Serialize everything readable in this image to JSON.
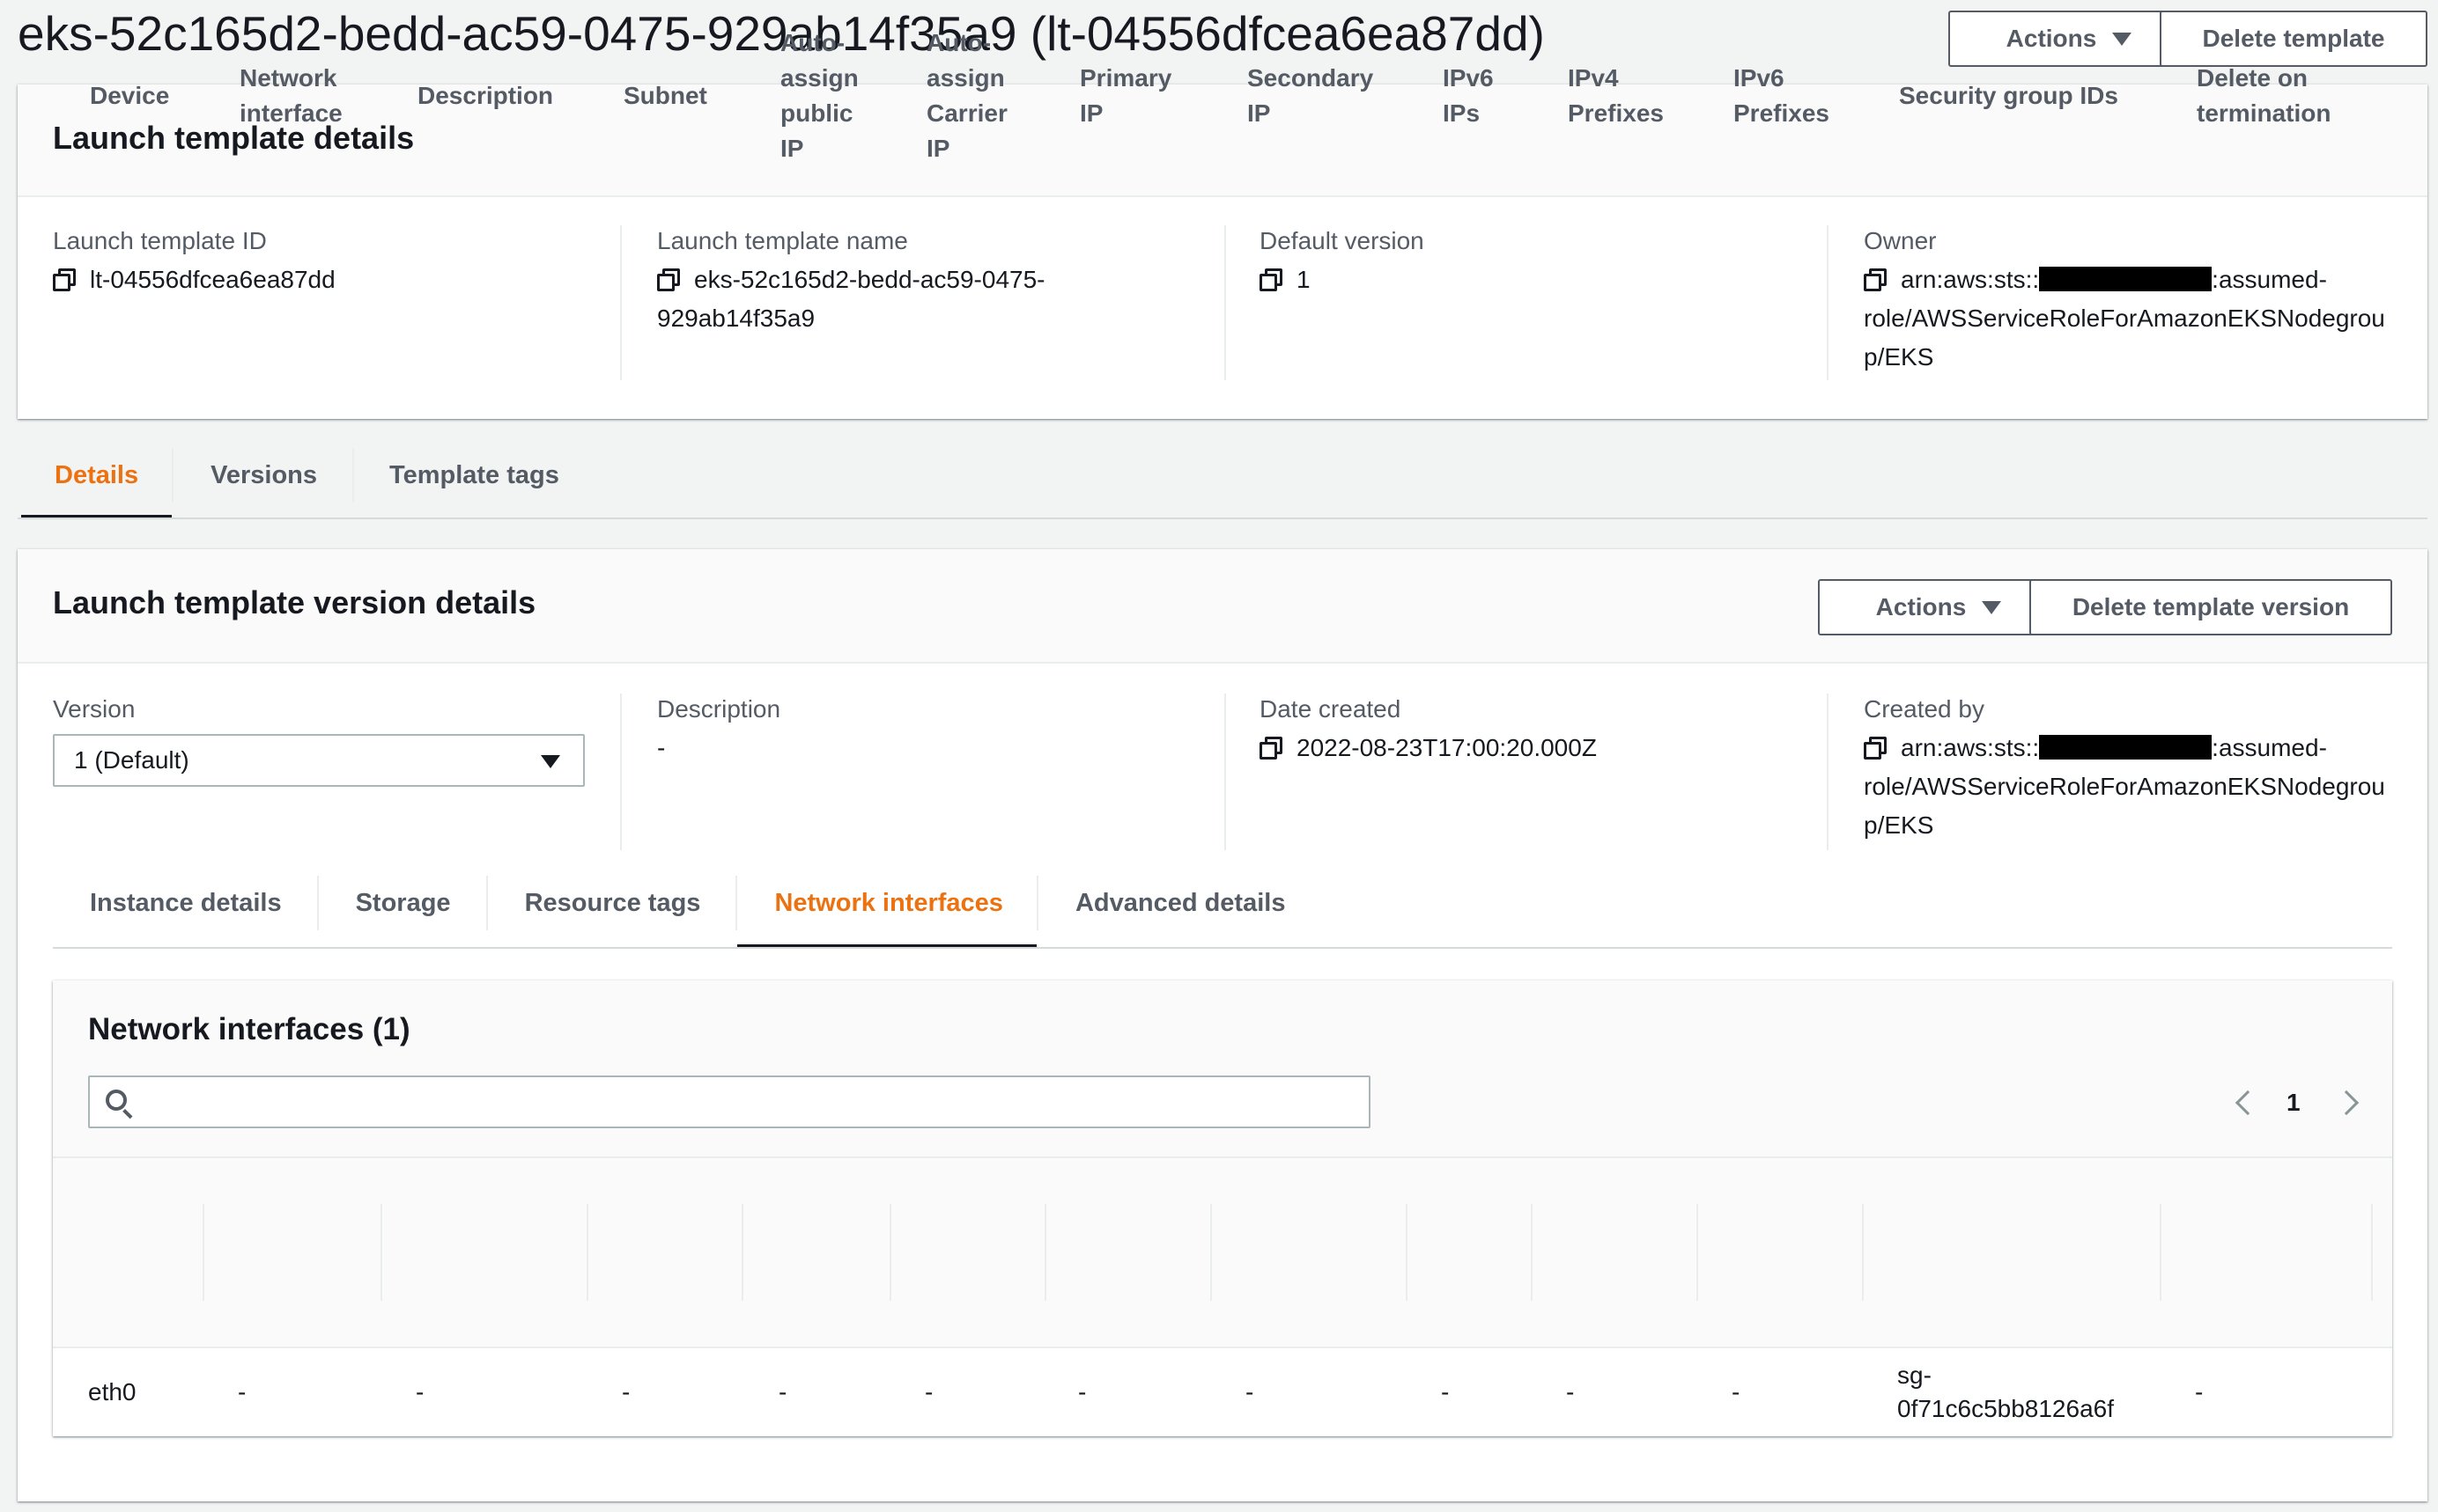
{
  "page": {
    "title": "eks-52c165d2-bedd-ac59-0475-929ab14f35a9 (lt-04556dfcea6ea87dd)",
    "actions_label": "Actions",
    "delete_label": "Delete template"
  },
  "template_details": {
    "title": "Launch template details",
    "fields": [
      {
        "label": "Launch template ID",
        "value": "lt-04556dfcea6ea87dd"
      },
      {
        "label": "Launch template name",
        "value_line1": "eks-52c165d2-bedd-ac59-0475-",
        "value_line2": "929ab14f35a9"
      },
      {
        "label": "Default version",
        "value": "1"
      },
      {
        "label": "Owner",
        "value_prefix": "arn:aws:sts::",
        "value_suffix": ":assumed-",
        "value_line2": "role/AWSServiceRoleForAmazonEKSNodegrou",
        "value_line3": "p/EKS"
      }
    ]
  },
  "main_tabs": [
    {
      "label": "Details",
      "active": true
    },
    {
      "label": "Versions",
      "active": false
    },
    {
      "label": "Template tags",
      "active": false
    }
  ],
  "version_details": {
    "title": "Launch template version details",
    "actions_label": "Actions",
    "delete_label": "Delete template version",
    "version": {
      "label": "Version",
      "selected": "1 (Default)"
    },
    "description": {
      "label": "Description",
      "value": "-"
    },
    "date_created": {
      "label": "Date created",
      "value": "2022-08-23T17:00:20.000Z"
    },
    "created_by": {
      "label": "Created by",
      "value_prefix": "arn:aws:sts::",
      "value_suffix": ":assumed-",
      "value_line2": "role/AWSServiceRoleForAmazonEKSNodegrou",
      "value_line3": "p/EKS"
    }
  },
  "sub_tabs": [
    {
      "label": "Instance details",
      "active": false
    },
    {
      "label": "Storage",
      "active": false
    },
    {
      "label": "Resource tags",
      "active": false
    },
    {
      "label": "Network interfaces",
      "active": true
    },
    {
      "label": "Advanced details",
      "active": false
    }
  ],
  "network_interfaces": {
    "title": "Network interfaces (1)",
    "search_placeholder": "",
    "page_number": "1",
    "columns": [
      [
        "Device"
      ],
      [
        "Network",
        "interface"
      ],
      [
        "Description"
      ],
      [
        "Subnet"
      ],
      [
        "Auto-",
        "assign",
        "public",
        "IP"
      ],
      [
        "Auto-",
        "assign",
        "Carrier",
        "IP"
      ],
      [
        "Primary",
        "IP"
      ],
      [
        "Secondary",
        "IP"
      ],
      [
        "IPv6",
        "IPs"
      ],
      [
        "IPv4",
        "Prefixes"
      ],
      [
        "IPv6",
        "Prefixes"
      ],
      [
        "Security group IDs"
      ],
      [
        "Delete on",
        "termination"
      ]
    ],
    "rows": [
      [
        "eth0",
        "-",
        "-",
        "-",
        "-",
        "-",
        "-",
        "-",
        "-",
        "-",
        "-",
        "sg-\n0f71c6c5bb8126a6f",
        "-"
      ]
    ]
  },
  "colors": {
    "accent": "#ec7211",
    "text": "#16191f",
    "muted": "#545b64",
    "background": "#f2f3f3"
  }
}
